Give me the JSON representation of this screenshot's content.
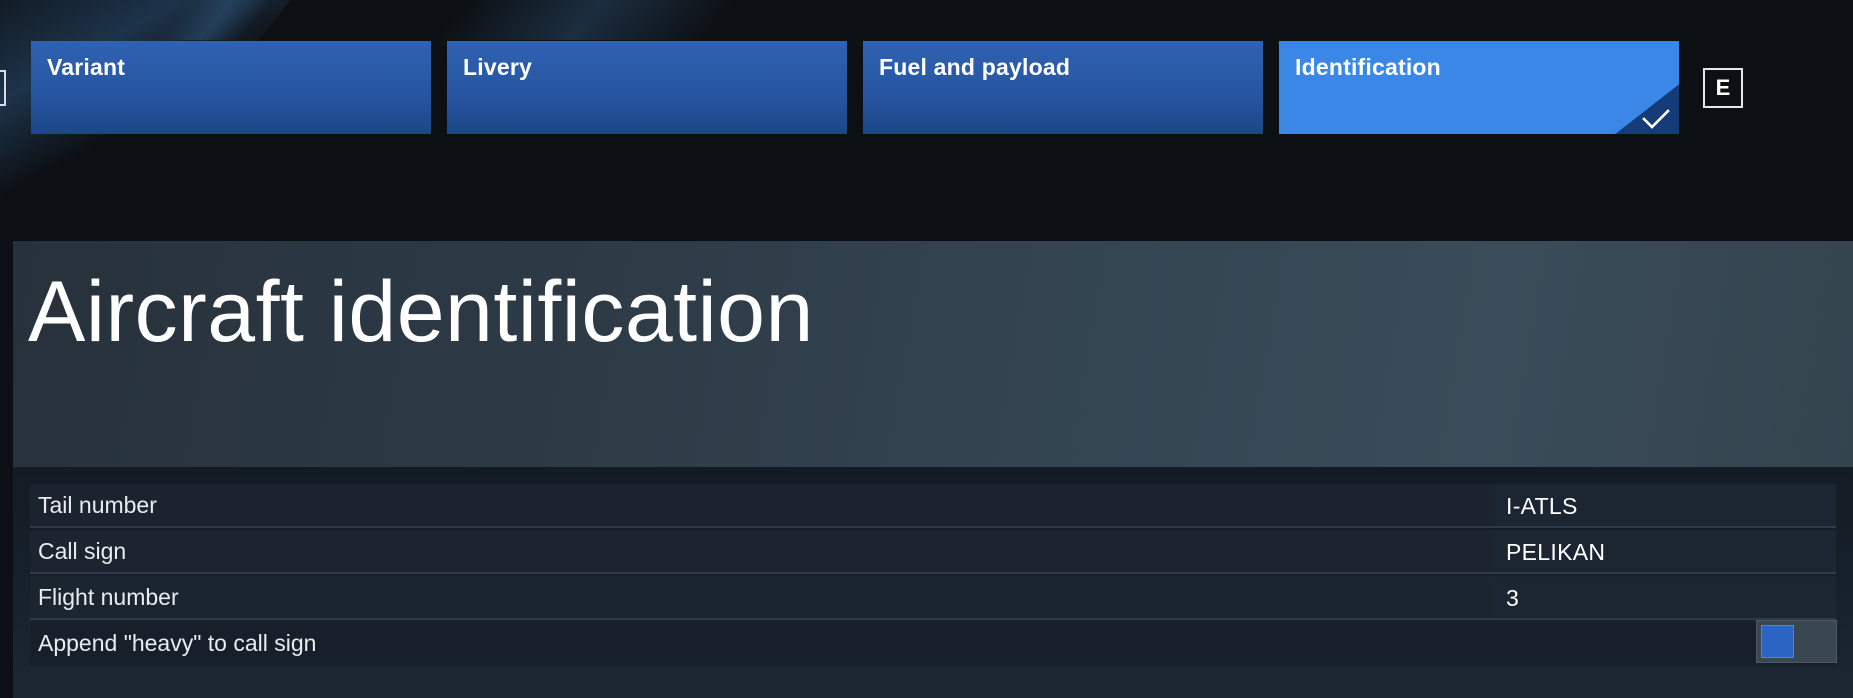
{
  "tabs": [
    {
      "label": "Variant",
      "active": false
    },
    {
      "label": "Livery",
      "active": false
    },
    {
      "label": "Fuel and payload",
      "active": false
    },
    {
      "label": "Identification",
      "active": true
    }
  ],
  "next_key": "E",
  "page": {
    "title": "Aircraft identification"
  },
  "settings": {
    "tail_number": {
      "label": "Tail number",
      "value": "I-ATLS"
    },
    "call_sign": {
      "label": "Call sign",
      "value": "PELIKAN"
    },
    "flight_number": {
      "label": "Flight number",
      "value": "3"
    },
    "append_heavy": {
      "label": "Append \"heavy\" to call sign",
      "enabled": false
    }
  },
  "colors": {
    "tab": "#2b5ba8",
    "tab_active": "#3a87e8",
    "background": "#0c0f13",
    "toggle_knob": "#2b63c2"
  },
  "icons": {
    "active_tab_check": "checkmark-icon"
  }
}
